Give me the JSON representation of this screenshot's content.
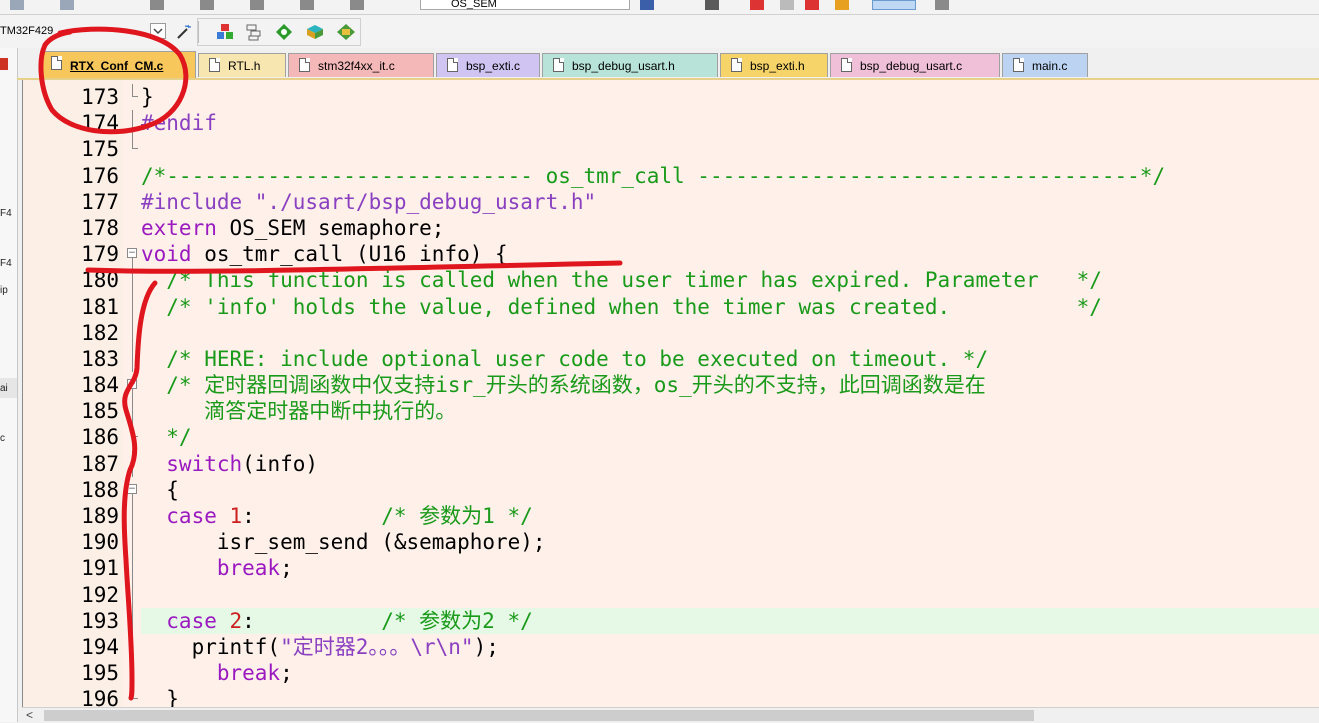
{
  "toolbar": {
    "target_selector": "OS_SEM",
    "target_label": "TM32F429"
  },
  "tabs": [
    {
      "label": "RTX_Conf_CM.c",
      "color": "#f7c75b",
      "active": true
    },
    {
      "label": "RTL.h",
      "color": "#f8e6b0"
    },
    {
      "label": "stm32f4xx_it.c",
      "color": "#f4b8b8"
    },
    {
      "label": "bsp_exti.c",
      "color": "#cfc4f2"
    },
    {
      "label": "bsp_debug_usart.h",
      "color": "#b7e3d8"
    },
    {
      "label": "bsp_exti.h",
      "color": "#f6d46a"
    },
    {
      "label": "bsp_debug_usart.c",
      "color": "#efc0d8"
    },
    {
      "label": "main.c",
      "color": "#bcd4f2"
    }
  ],
  "left_strip": [
    "F4",
    "F4",
    "ip",
    "ai",
    "c"
  ],
  "editor": {
    "lines": [
      {
        "n": "173",
        "fold": "end",
        "parts": [
          [
            "tx",
            "}"
          ]
        ]
      },
      {
        "n": "174",
        "fold": "line",
        "parts": [
          [
            "pp",
            "#endif"
          ]
        ]
      },
      {
        "n": "175",
        "fold": "end",
        "parts": []
      },
      {
        "n": "176",
        "parts": [
          [
            "cm",
            "/*----------------------------- os_tmr_call -----------------------------------*/"
          ]
        ]
      },
      {
        "n": "177",
        "parts": [
          [
            "pp",
            "#include \"./usart/bsp_debug_usart.h\""
          ]
        ]
      },
      {
        "n": "178",
        "parts": [
          [
            "kw",
            "extern"
          ],
          [
            "tx",
            " OS_SEM semaphore;"
          ]
        ]
      },
      {
        "n": "179",
        "fold": "box",
        "parts": [
          [
            "kw",
            "void"
          ],
          [
            "tx",
            " os_tmr_call (U16 info) {"
          ]
        ]
      },
      {
        "n": "180",
        "fold": "line",
        "parts": [
          [
            "cm",
            "  /* This function is called when the user timer has expired. Parameter   */"
          ]
        ]
      },
      {
        "n": "181",
        "fold": "line",
        "parts": [
          [
            "cm",
            "  /* 'info' holds the value, defined when the timer was created.          */"
          ]
        ]
      },
      {
        "n": "182",
        "fold": "line",
        "parts": []
      },
      {
        "n": "183",
        "fold": "line",
        "parts": [
          [
            "cm",
            "  /* HERE: include optional user code to be executed on timeout. */"
          ]
        ]
      },
      {
        "n": "184",
        "fold": "box",
        "parts": [
          [
            "cm",
            "  /* 定时器回调函数中仅支持isr_开头的系统函数，os_开头的不支持，此回调函数是在"
          ]
        ]
      },
      {
        "n": "185",
        "fold": "line",
        "parts": [
          [
            "cm",
            "     滴答定时器中断中执行的。"
          ]
        ]
      },
      {
        "n": "186",
        "fold": "end",
        "parts": [
          [
            "cm",
            "  */"
          ]
        ]
      },
      {
        "n": "187",
        "fold": "line",
        "parts": [
          [
            "kw",
            "  switch"
          ],
          [
            "tx",
            "(info)"
          ]
        ]
      },
      {
        "n": "188",
        "fold": "box",
        "parts": [
          [
            "tx",
            "  {"
          ]
        ]
      },
      {
        "n": "189",
        "fold": "line",
        "parts": [
          [
            "kw",
            "  case"
          ],
          [
            "tx",
            " "
          ],
          [
            "nm",
            "1"
          ],
          [
            "tx",
            ":          "
          ],
          [
            "cm",
            "/* 参数为1 */"
          ]
        ]
      },
      {
        "n": "190",
        "fold": "line",
        "parts": [
          [
            "tx",
            "      isr_sem_send (&semaphore);"
          ]
        ]
      },
      {
        "n": "191",
        "fold": "line",
        "parts": [
          [
            "kw",
            "      break"
          ],
          [
            "tx",
            ";"
          ]
        ]
      },
      {
        "n": "192",
        "fold": "line",
        "parts": []
      },
      {
        "n": "193",
        "fold": "line",
        "current": true,
        "parts": [
          [
            "kw",
            "  case"
          ],
          [
            "tx",
            " "
          ],
          [
            "nm",
            "2"
          ],
          [
            "tx",
            ":          "
          ],
          [
            "cm",
            "/* 参数为2 */"
          ]
        ]
      },
      {
        "n": "194",
        "fold": "line",
        "parts": [
          [
            "tx",
            "    printf("
          ],
          [
            "str",
            "\"定时器2。。。\\r\\n\""
          ],
          [
            "tx",
            ");"
          ]
        ]
      },
      {
        "n": "195",
        "fold": "line",
        "parts": [
          [
            "kw",
            "      break"
          ],
          [
            "tx",
            ";"
          ]
        ]
      },
      {
        "n": "196",
        "fold": "end",
        "parts": [
          [
            "tx",
            "  }"
          ]
        ]
      }
    ]
  },
  "colors": {
    "keyword": "#9a1ac0",
    "comment": "#1a9a1a",
    "number": "#cc2020",
    "annotation": "#e0161e"
  }
}
